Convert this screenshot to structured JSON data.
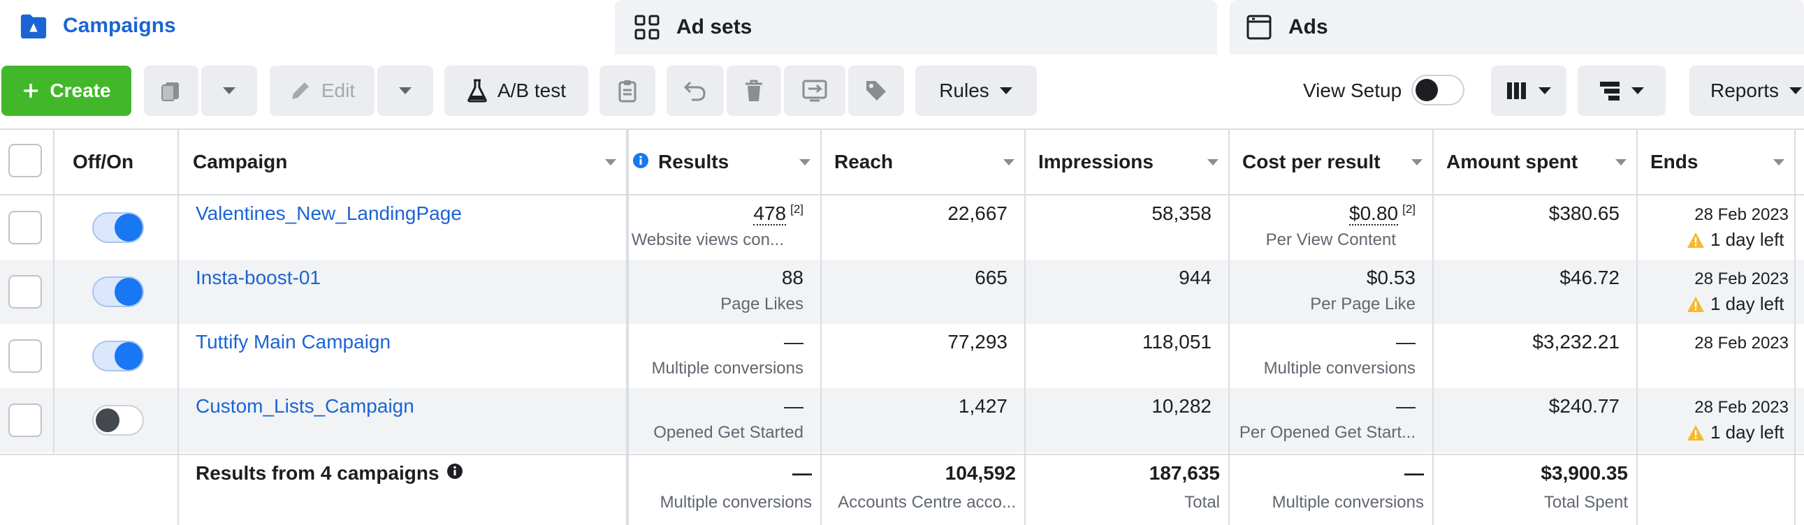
{
  "tabs": {
    "campaigns": "Campaigns",
    "adsets": "Ad sets",
    "ads": "Ads"
  },
  "toolbar": {
    "create": "Create",
    "edit": "Edit",
    "ab_test": "A/B test",
    "rules": "Rules",
    "view_setup": "View Setup",
    "reports": "Reports"
  },
  "columns": {
    "offon": "Off/On",
    "campaign": "Campaign",
    "results": "Results",
    "reach": "Reach",
    "impressions": "Impressions",
    "cost_per_result": "Cost per result",
    "amount_spent": "Amount spent",
    "ends": "Ends"
  },
  "rows": [
    {
      "name": "Valentines_New_LandingPage",
      "toggle_on": true,
      "results": "478",
      "results_note": "[2]",
      "results_sub": "Website views con...",
      "reach": "22,667",
      "impressions": "58,358",
      "cost": "$0.80",
      "cost_note": "[2]",
      "cost_sub": "Per View Content",
      "spent": "$380.65",
      "ends": "28 Feb 2023",
      "ends_warn": "1 day left"
    },
    {
      "name": "Insta-boost-01",
      "toggle_on": true,
      "results": "88",
      "results_sub": "Page Likes",
      "reach": "665",
      "impressions": "944",
      "cost": "$0.53",
      "cost_sub": "Per Page Like",
      "spent": "$46.72",
      "ends": "28 Feb 2023",
      "ends_warn": "1 day left"
    },
    {
      "name": "Tuttify Main Campaign",
      "toggle_on": true,
      "results": "—",
      "results_sub": "Multiple conversions",
      "reach": "77,293",
      "impressions": "118,051",
      "cost": "—",
      "cost_sub": "Multiple conversions",
      "spent": "$3,232.21",
      "ends": "28 Feb 2023"
    },
    {
      "name": "Custom_Lists_Campaign",
      "toggle_on": false,
      "results": "—",
      "results_sub": "Opened Get Started",
      "reach": "1,427",
      "impressions": "10,282",
      "cost": "—",
      "cost_sub": "Per Opened Get Start...",
      "spent": "$240.77",
      "ends": "28 Feb 2023",
      "ends_warn": "1 day left"
    }
  ],
  "totals": {
    "label": "Results from 4 campaigns",
    "results": "—",
    "results_sub": "Multiple conversions",
    "reach": "104,592",
    "reach_sub": "Accounts Centre acco...",
    "impressions": "187,635",
    "impressions_sub": "Total",
    "cost": "—",
    "cost_sub": "Multiple conversions",
    "spent": "$3,900.35",
    "spent_sub": "Total Spent"
  },
  "colors": {
    "accent": "#1b64d4",
    "create_green": "#42b72a",
    "toggle_blue": "#1877f2",
    "warning": "#f7b928"
  }
}
